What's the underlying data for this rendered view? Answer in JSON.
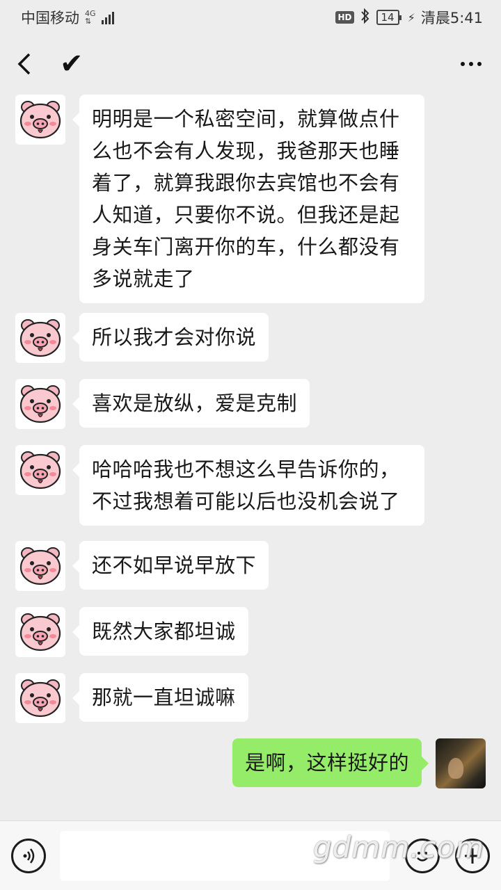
{
  "status_bar": {
    "carrier": "中国移动",
    "network_tag_top": "4G",
    "network_tag_bottom": "⇅",
    "hd": "HD",
    "battery": "14",
    "time": "清晨5:41"
  },
  "header": {
    "title": "✔"
  },
  "messages": [
    {
      "side": "left",
      "text": "明明是一个私密空间，就算做点什么也不会有人发现，我爸那天也睡着了，就算我跟你去宾馆也不会有人知道，只要你不说。但我还是起身关车门离开你的车，什么都没有多说就走了"
    },
    {
      "side": "left",
      "text": "所以我才会对你说"
    },
    {
      "side": "left",
      "text": "喜欢是放纵，爱是克制"
    },
    {
      "side": "left",
      "text": "哈哈哈我也不想这么早告诉你的，不过我想着可能以后也没机会说了"
    },
    {
      "side": "left",
      "text": "还不如早说早放下"
    },
    {
      "side": "left",
      "text": "既然大家都坦诚"
    },
    {
      "side": "left",
      "text": "那就一直坦诚嘛"
    },
    {
      "side": "right",
      "text": "是啊，这样挺好的"
    }
  ],
  "input_bar": {
    "value": ""
  },
  "watermark": "gdmm.com",
  "colors": {
    "background": "#ededed",
    "bubble_in": "#ffffff",
    "bubble_out": "#95ec69"
  }
}
